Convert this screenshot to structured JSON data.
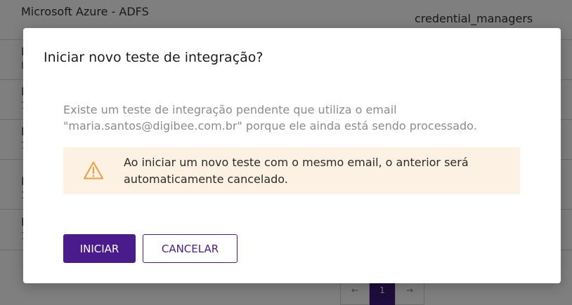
{
  "background": {
    "rows": [
      {
        "name": "Microsoft Azure - ADFS",
        "sub": "",
        "right": "credential_managers"
      },
      {
        "name": "I",
        "sub": "I"
      },
      {
        "name": "I",
        "sub": "1"
      },
      {
        "name": "I",
        "sub": "1"
      },
      {
        "name": "I",
        "sub": "1"
      },
      {
        "name": "I",
        "sub": "1"
      }
    ],
    "pagination": {
      "prev": "←",
      "current": "1",
      "next": "→"
    }
  },
  "dialog": {
    "title": "Iniciar novo teste de integração?",
    "message": "Existe um teste de integração pendente que utiliza o email \"maria.santos@digibee.com.br\" porque ele ainda está sendo processado.",
    "warning": {
      "icon": "warning-triangle-icon",
      "text": "Ao iniciar um novo teste com o mesmo email, o anterior será automaticamente cancelado.",
      "color": "#f39c3a",
      "background": "#fdf1e3"
    },
    "buttons": {
      "primary": "INICIAR",
      "secondary": "CANCELAR"
    },
    "accent_color": "#4a1b8c"
  }
}
